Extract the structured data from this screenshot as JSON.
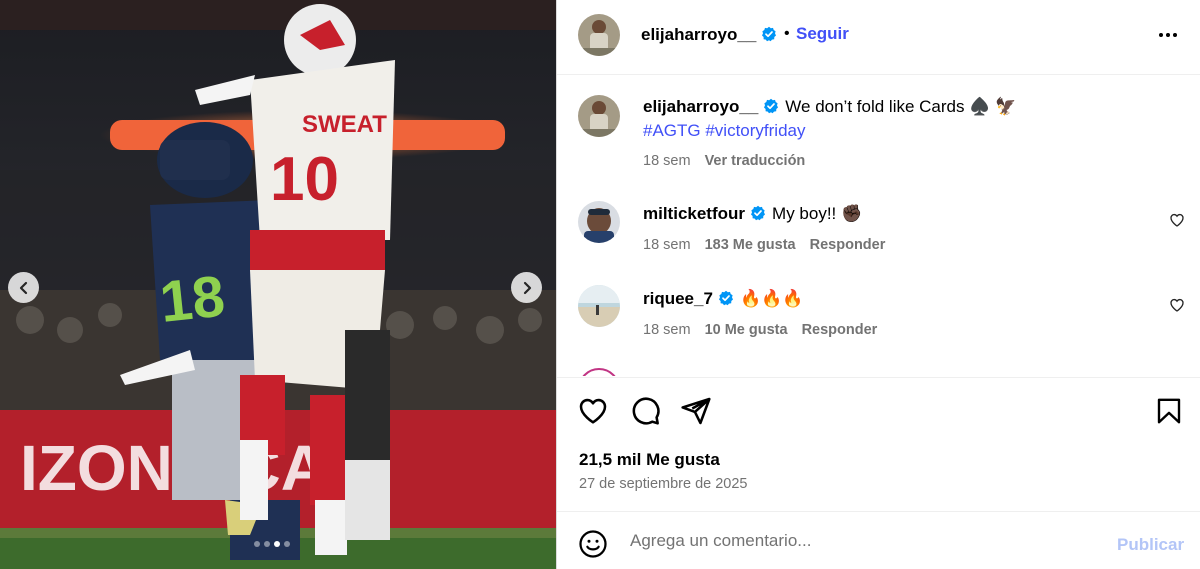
{
  "header": {
    "username": "elijaharroyo__",
    "separator": "•",
    "follow_label": "Seguir"
  },
  "caption": {
    "username": "elijaharroyo__",
    "text": "We don’t fold like Cards ♠️ 🦅",
    "hashtags": "#AGTG #victoryfriday",
    "age": "18 sem",
    "translate_label": "Ver traducción"
  },
  "comments": [
    {
      "username": "milticketfour",
      "text": "My boy!! ✊🏿",
      "age": "18 sem",
      "likes": "183 Me gusta",
      "reply_label": "Responder"
    },
    {
      "username": "riquee_7",
      "text": "🔥🔥🔥",
      "age": "18 sem",
      "likes": "10 Me gusta",
      "reply_label": "Responder"
    }
  ],
  "actions": {
    "likes_count": "21,5 mil Me gusta",
    "date": "27 de septiembre de 2025"
  },
  "composer": {
    "placeholder": "Agrega un comentario...",
    "publish_label": "Publicar"
  },
  "carousel": {
    "slide_count": 4,
    "active_index": 2
  },
  "colors": {
    "link": "#4150f7",
    "verified": "#0095f6",
    "meta": "#737373",
    "publish_disabled": "#b3c5f7"
  },
  "icons": [
    "chevron-left-icon",
    "chevron-right-icon",
    "verified-icon",
    "more-icon",
    "heart-icon",
    "comment-icon",
    "share-icon",
    "bookmark-icon",
    "emoji-icon"
  ]
}
